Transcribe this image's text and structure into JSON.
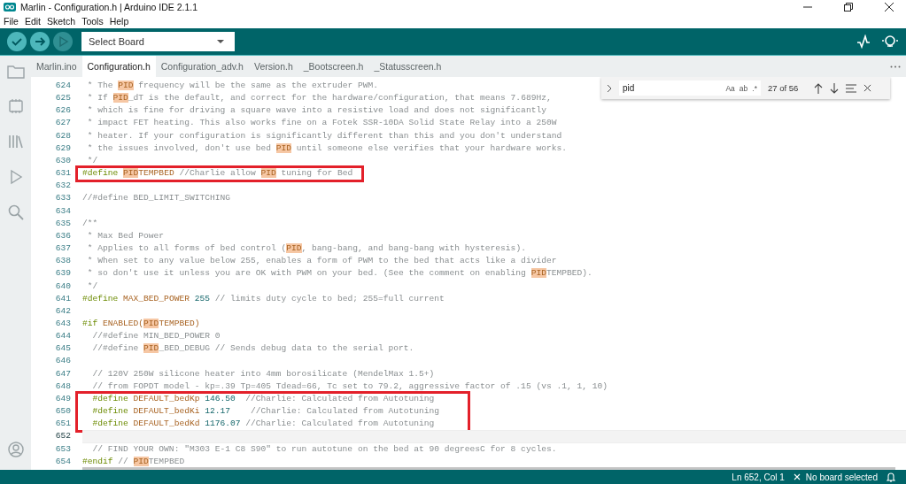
{
  "window": {
    "title": "Marlin - Configuration.h | Arduino IDE 2.1.1"
  },
  "menu": [
    "File",
    "Edit",
    "Sketch",
    "Tools",
    "Help"
  ],
  "toolbar": {
    "board_select": "Select Board"
  },
  "tabs": [
    {
      "label": "Marlin.ino",
      "selected": false
    },
    {
      "label": "Configuration.h",
      "selected": true
    },
    {
      "label": "Configuration_adv.h",
      "selected": false
    },
    {
      "label": "Version.h",
      "selected": false
    },
    {
      "label": "_Bootscreen.h",
      "selected": false
    },
    {
      "label": "_Statusscreen.h",
      "selected": false
    }
  ],
  "find": {
    "value": "pid",
    "options": [
      "Aa",
      "ab",
      ".*"
    ],
    "count": "27 of 56"
  },
  "code": [
    {
      "number": "624",
      "current": false,
      "boxed": false,
      "tokens": [
        {
          "text": " * The ",
          "kind": "comment"
        },
        {
          "text": "PID",
          "kind": "hit"
        },
        {
          "text": " frequency will be the same as the extruder PWM.",
          "kind": "comment"
        }
      ]
    },
    {
      "number": "625",
      "current": false,
      "boxed": false,
      "tokens": [
        {
          "text": " * If ",
          "kind": "comment"
        },
        {
          "text": "PID",
          "kind": "hit"
        },
        {
          "text": "_dT is the default, and correct for the hardware/configuration, that means 7.689Hz,",
          "kind": "comment"
        }
      ]
    },
    {
      "number": "626",
      "current": false,
      "boxed": false,
      "tokens": [
        {
          "text": " * which is fine for driving a square wave into a resistive load and does not significantly",
          "kind": "comment"
        }
      ]
    },
    {
      "number": "627",
      "current": false,
      "boxed": false,
      "tokens": [
        {
          "text": " * impact FET heating. This also works fine on a Fotek SSR-10DA Solid State Relay into a 250W",
          "kind": "comment"
        }
      ]
    },
    {
      "number": "628",
      "current": false,
      "boxed": false,
      "tokens": [
        {
          "text": " * heater. If your configuration is significantly different than this and you don't understand",
          "kind": "comment"
        }
      ]
    },
    {
      "number": "629",
      "current": false,
      "boxed": false,
      "tokens": [
        {
          "text": " * the issues involved, don't use bed ",
          "kind": "comment"
        },
        {
          "text": "PID",
          "kind": "hit"
        },
        {
          "text": " until someone else verifies that your hardware works.",
          "kind": "comment"
        }
      ]
    },
    {
      "number": "630",
      "current": false,
      "boxed": false,
      "tokens": [
        {
          "text": " */",
          "kind": "comment"
        }
      ]
    },
    {
      "number": "631",
      "current": false,
      "boxed": true,
      "tokens": [
        {
          "text": "#define ",
          "kind": "directive"
        },
        {
          "text": "PID",
          "kind": "hit"
        },
        {
          "text": "TEMPBED",
          "kind": "macro"
        },
        {
          "text": " //Charlie allow ",
          "kind": "comment"
        },
        {
          "text": "PID",
          "kind": "hit"
        },
        {
          "text": " tuning for Bed",
          "kind": "comment"
        }
      ]
    },
    {
      "number": "632",
      "current": false,
      "boxed": false
    },
    {
      "number": "633",
      "current": false,
      "boxed": false,
      "tokens": [
        {
          "text": "//#define BED_LIMIT_SWITCHING",
          "kind": "comment"
        }
      ]
    },
    {
      "number": "634",
      "current": false,
      "boxed": false
    },
    {
      "number": "635",
      "current": false,
      "boxed": false,
      "tokens": [
        {
          "text": "/**",
          "kind": "comment"
        }
      ]
    },
    {
      "number": "636",
      "current": false,
      "boxed": false,
      "tokens": [
        {
          "text": " * Max Bed Power",
          "kind": "comment"
        }
      ]
    },
    {
      "number": "637",
      "current": false,
      "boxed": false,
      "tokens": [
        {
          "text": " * Applies to all forms of bed control (",
          "kind": "comment"
        },
        {
          "text": "PID",
          "kind": "hit"
        },
        {
          "text": ", bang-bang, and bang-bang with hysteresis).",
          "kind": "comment"
        }
      ]
    },
    {
      "number": "638",
      "current": false,
      "boxed": false,
      "tokens": [
        {
          "text": " * When set to any value below 255, enables a form of PWM to the bed that acts like a divider",
          "kind": "comment"
        }
      ]
    },
    {
      "number": "639",
      "current": false,
      "boxed": false,
      "tokens": [
        {
          "text": " * so don't use it unless you are OK with PWM on your bed. (See the comment on enabling ",
          "kind": "comment"
        },
        {
          "text": "PID",
          "kind": "hit"
        },
        {
          "text": "TEMPBED).",
          "kind": "comment"
        }
      ]
    },
    {
      "number": "640",
      "current": false,
      "boxed": false,
      "tokens": [
        {
          "text": " */",
          "kind": "comment"
        }
      ]
    },
    {
      "number": "641",
      "current": false,
      "boxed": false,
      "tokens": [
        {
          "text": "#define ",
          "kind": "directive"
        },
        {
          "text": "MAX_BED_POWER ",
          "kind": "macro"
        },
        {
          "text": "255",
          "kind": "number"
        },
        {
          "text": " // limits duty cycle to bed; 255=full current",
          "kind": "comment"
        }
      ]
    },
    {
      "number": "642",
      "current": false,
      "boxed": false
    },
    {
      "number": "643",
      "current": false,
      "boxed": false,
      "tokens": [
        {
          "text": "#if ",
          "kind": "directive"
        },
        {
          "text": "ENABLED(",
          "kind": "macro"
        },
        {
          "text": "PID",
          "kind": "hit"
        },
        {
          "text": "TEMPBED)",
          "kind": "macro"
        }
      ]
    },
    {
      "number": "644",
      "current": false,
      "boxed": false,
      "tokens": [
        {
          "text": "  //#define MIN_BED_POWER 0",
          "kind": "comment"
        }
      ]
    },
    {
      "number": "645",
      "current": false,
      "boxed": false,
      "tokens": [
        {
          "text": "  //#define ",
          "kind": "comment"
        },
        {
          "text": "PID",
          "kind": "hit"
        },
        {
          "text": "_BED_DEBUG // Sends debug data to the serial port.",
          "kind": "comment"
        }
      ]
    },
    {
      "number": "646",
      "current": false,
      "boxed": false
    },
    {
      "number": "647",
      "current": false,
      "boxed": false,
      "tokens": [
        {
          "text": "  // 120V 250W silicone heater into 4mm borosilicate (MendelMax 1.5+)",
          "kind": "comment"
        }
      ]
    },
    {
      "number": "648",
      "current": false,
      "boxed": false,
      "tokens": [
        {
          "text": "  // from FOPDT model - kp=.39 Tp=405 Tdead=66, Tc set to 79.2, aggressive factor of .15 (vs .1, 1, 10)",
          "kind": "comment"
        }
      ]
    },
    {
      "number": "649",
      "current": false,
      "boxed": true,
      "tokens": [
        {
          "text": "  #define ",
          "kind": "directive"
        },
        {
          "text": "DEFAULT_bedKp ",
          "kind": "macro"
        },
        {
          "text": "146.50",
          "kind": "number"
        },
        {
          "text": "  //Charlie: Calculated from Autotuning",
          "kind": "comment"
        }
      ]
    },
    {
      "number": "650",
      "current": false,
      "boxed": true,
      "tokens": [
        {
          "text": "  #define ",
          "kind": "directive"
        },
        {
          "text": "DEFAULT_bedKi ",
          "kind": "macro"
        },
        {
          "text": "12.17",
          "kind": "number"
        },
        {
          "text": "    //Charlie: Calculated from Autotuning",
          "kind": "comment"
        }
      ]
    },
    {
      "number": "651",
      "current": false,
      "boxed": true,
      "tokens": [
        {
          "text": "  #define ",
          "kind": "directive"
        },
        {
          "text": "DEFAULT_bedKd ",
          "kind": "macro"
        },
        {
          "text": "1176.07",
          "kind": "number"
        },
        {
          "text": " //Charlie: Calculated from Autotuning",
          "kind": "comment"
        }
      ]
    },
    {
      "number": "652",
      "current": true,
      "boxed": false
    },
    {
      "number": "653",
      "current": false,
      "boxed": false,
      "tokens": [
        {
          "text": "  // FIND YOUR OWN: \"M303 E-1 C8 S90\" to run autotune on the bed at 90 degreesC for 8 cycles.",
          "kind": "comment"
        }
      ]
    },
    {
      "number": "654",
      "current": false,
      "boxed": false,
      "tokens": [
        {
          "text": "#endif",
          "kind": "directive"
        },
        {
          "text": " // ",
          "kind": "comment"
        },
        {
          "text": "PID",
          "kind": "hit"
        },
        {
          "text": "TEMPBED",
          "kind": "comment"
        }
      ]
    }
  ],
  "status_bar": {
    "position": "Ln 652, Col 1",
    "board": "No board selected"
  }
}
